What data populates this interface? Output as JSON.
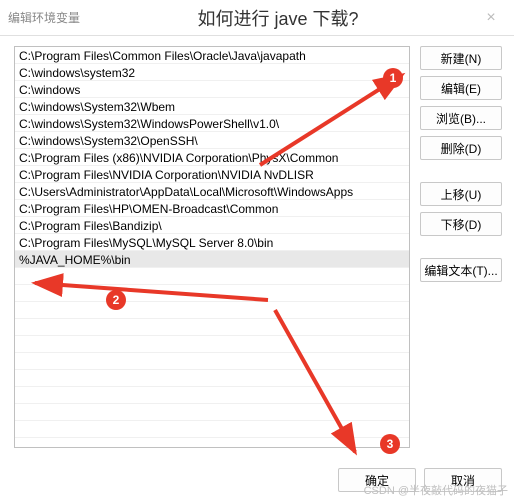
{
  "titlebar": {
    "label": "编辑环境变量",
    "title": "如何进行 jave 下载?",
    "close": "×"
  },
  "list": {
    "items": [
      "C:\\Program Files\\Common Files\\Oracle\\Java\\javapath",
      "C:\\windows\\system32",
      "C:\\windows",
      "C:\\windows\\System32\\Wbem",
      "C:\\windows\\System32\\WindowsPowerShell\\v1.0\\",
      "C:\\windows\\System32\\OpenSSH\\",
      "C:\\Program Files (x86)\\NVIDIA Corporation\\PhysX\\Common",
      "C:\\Program Files\\NVIDIA Corporation\\NVIDIA NvDLISR",
      "C:\\Users\\Administrator\\AppData\\Local\\Microsoft\\WindowsApps",
      "C:\\Program Files\\HP\\OMEN-Broadcast\\Common",
      "C:\\Program Files\\Bandizip\\",
      "C:\\Program Files\\MySQL\\MySQL Server 8.0\\bin",
      "%JAVA_HOME%\\bin"
    ],
    "selected_index": 12
  },
  "buttons": {
    "new": "新建(N)",
    "edit": "编辑(E)",
    "browse": "浏览(B)...",
    "delete": "删除(D)",
    "moveup": "上移(U)",
    "movedown": "下移(D)",
    "edittext": "编辑文本(T)...",
    "ok": "确定",
    "cancel": "取消"
  },
  "annotations": {
    "badge1": "1",
    "badge2": "2",
    "badge3": "3",
    "arrow_color": "#e83828"
  },
  "watermark": "CSDN @半夜敲代码的夜猫子"
}
